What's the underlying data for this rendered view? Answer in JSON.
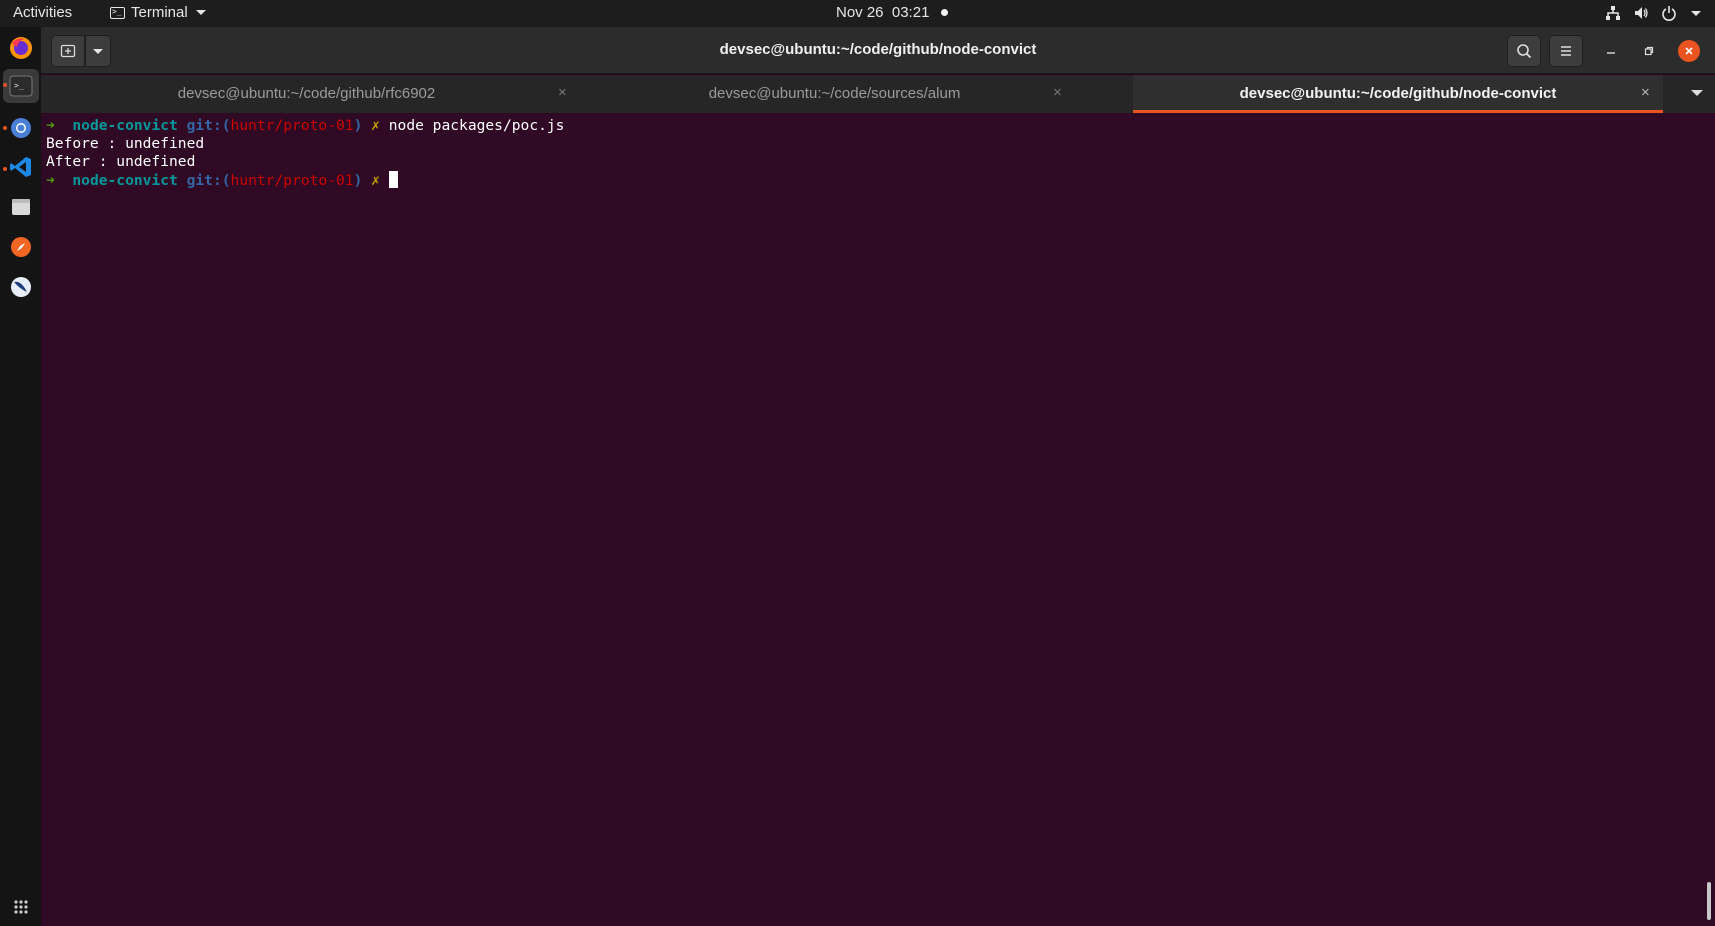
{
  "topbar": {
    "activities": "Activities",
    "app_name": "Terminal",
    "date": "Nov 26",
    "time": "03:21"
  },
  "window": {
    "title": "devsec@ubuntu:~/code/github/node-convict"
  },
  "tabs": [
    {
      "label": "devsec@ubuntu:~/code/github/rfc6902",
      "active": false
    },
    {
      "label": "devsec@ubuntu:~/code/sources/alum",
      "active": false
    },
    {
      "label": "devsec@ubuntu:~/code/github/node-convict",
      "active": true
    }
  ],
  "terminal": {
    "prompt_arrow": "➜",
    "prompt_dir": "node-convict",
    "prompt_git_prefix": "git:(",
    "prompt_branch": "huntr/proto-01",
    "prompt_git_suffix": ")",
    "prompt_dirty": "✗",
    "command": "node packages/poc.js",
    "output": [
      "Before : undefined",
      "After : undefined"
    ]
  },
  "colors": {
    "terminal_bg": "#300a24",
    "accent": "#e95420",
    "prompt_arrow": "#4e9a06",
    "prompt_dir": "#06989a",
    "prompt_git": "#3465a4",
    "prompt_branch": "#cc0000",
    "prompt_dirty": "#c4a000"
  },
  "dock_icons": [
    "firefox-icon",
    "terminal-icon",
    "chromium-icon",
    "vscode-icon",
    "files-icon",
    "compass-icon",
    "burp-icon",
    "app-grid-icon"
  ]
}
